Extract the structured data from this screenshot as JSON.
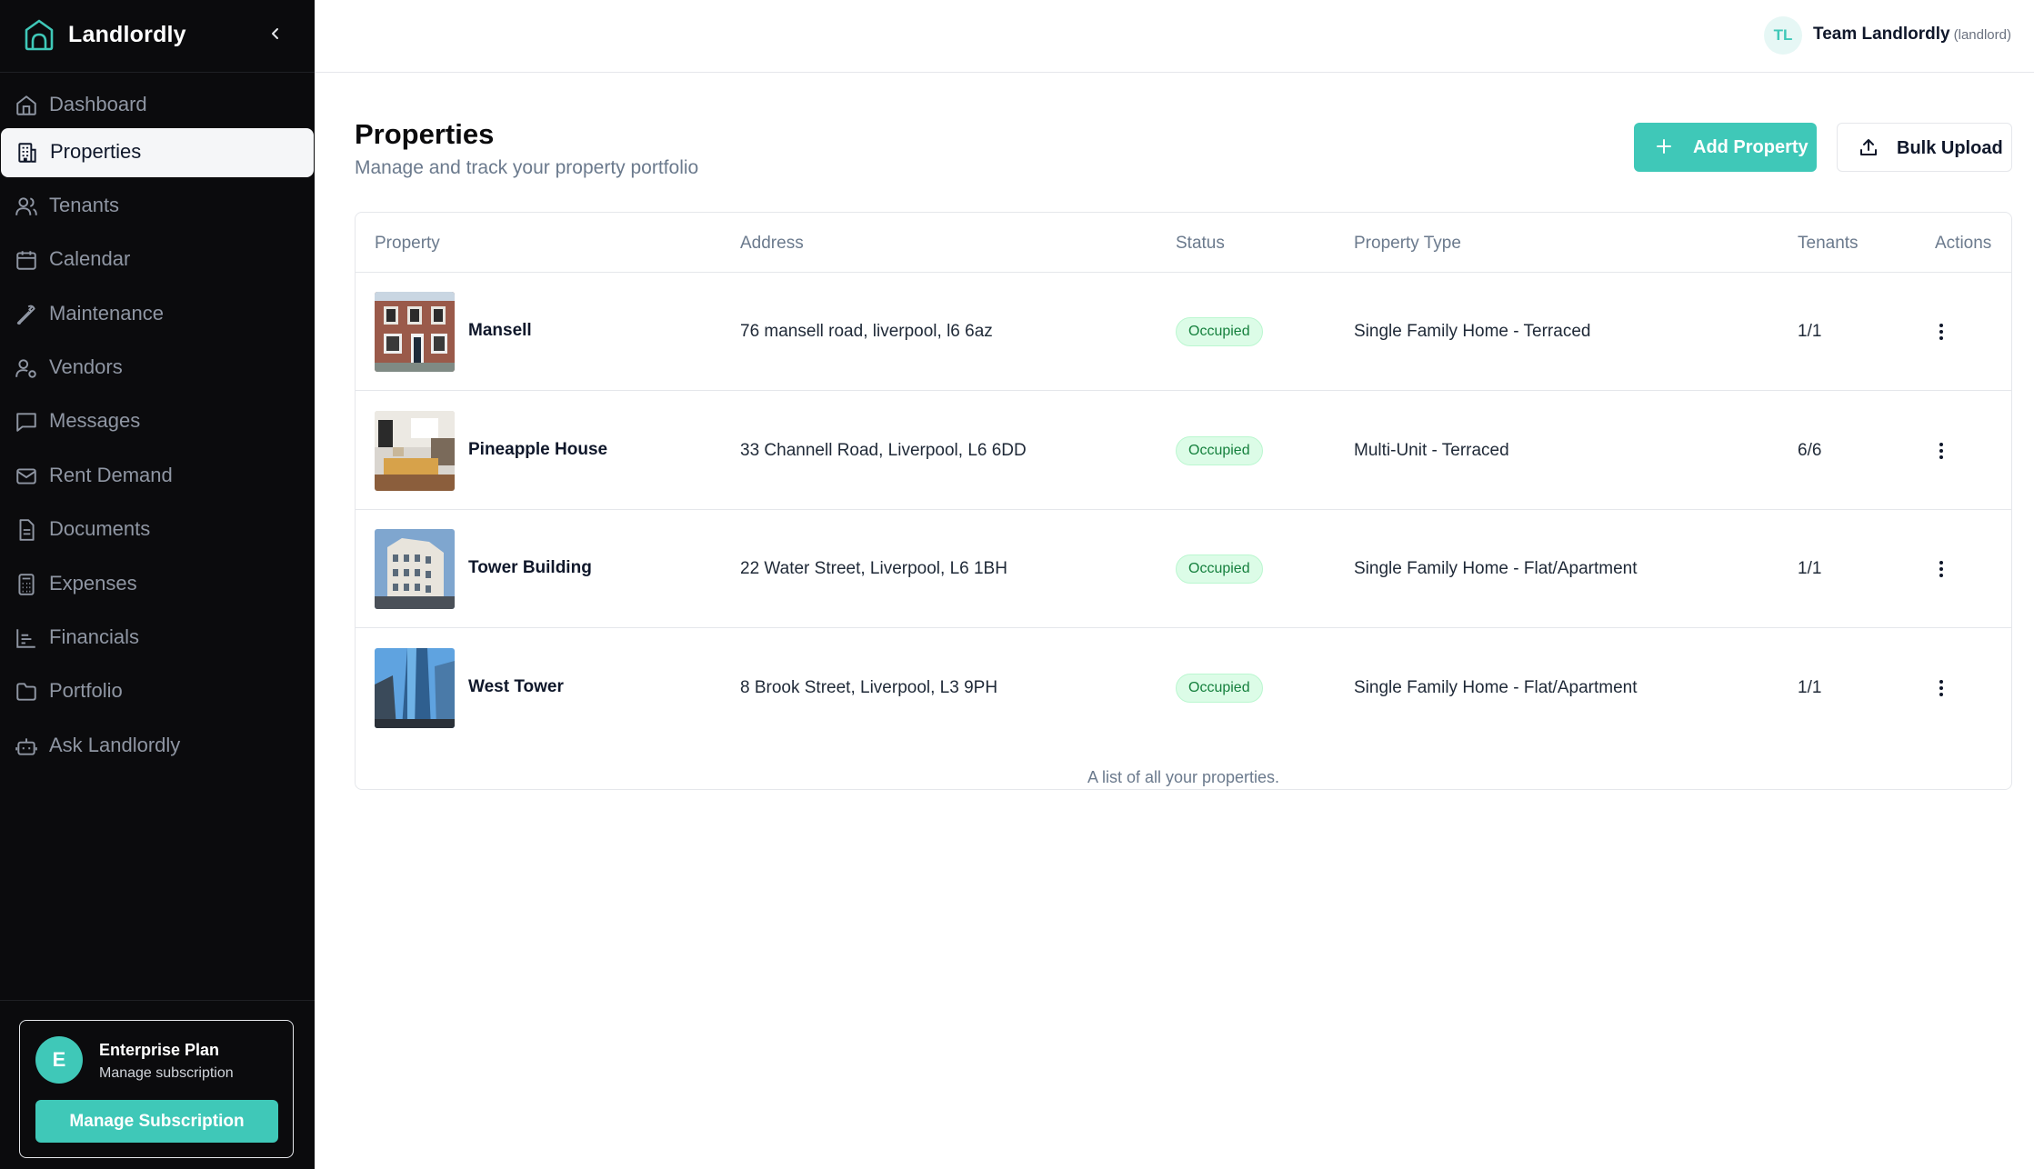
{
  "app": {
    "name": "Landlordly"
  },
  "sidebar": {
    "items": [
      {
        "label": "Dashboard",
        "icon": "home-icon"
      },
      {
        "label": "Properties",
        "icon": "building-icon",
        "active": true
      },
      {
        "label": "Tenants",
        "icon": "users-icon"
      },
      {
        "label": "Calendar",
        "icon": "calendar-icon"
      },
      {
        "label": "Maintenance",
        "icon": "wrench-icon"
      },
      {
        "label": "Vendors",
        "icon": "user-cog-icon"
      },
      {
        "label": "Messages",
        "icon": "message-icon"
      },
      {
        "label": "Rent Demand",
        "icon": "mail-icon"
      },
      {
        "label": "Documents",
        "icon": "file-icon"
      },
      {
        "label": "Expenses",
        "icon": "calculator-icon"
      },
      {
        "label": "Financials",
        "icon": "chart-icon"
      },
      {
        "label": "Portfolio",
        "icon": "folder-icon"
      },
      {
        "label": "Ask Landlordly",
        "icon": "bot-icon"
      }
    ],
    "plan": {
      "avatar": "E",
      "title": "Enterprise Plan",
      "subtitle": "Manage subscription",
      "button": "Manage Subscription"
    }
  },
  "topbar": {
    "user_initials": "TL",
    "user_name": "Team Landlordly",
    "user_role": "(landlord)"
  },
  "page": {
    "title": "Properties",
    "subtitle": "Manage and track your property portfolio",
    "add_button": "Add Property",
    "bulk_button": "Bulk Upload"
  },
  "table": {
    "headers": {
      "property": "Property",
      "address": "Address",
      "status": "Status",
      "type": "Property Type",
      "tenants": "Tenants",
      "actions": "Actions"
    },
    "rows": [
      {
        "name": "Mansell",
        "address": "76 mansell road, liverpool, l6 6az",
        "status": "Occupied",
        "type": "Single Family Home - Terraced",
        "tenants": "1/1"
      },
      {
        "name": "Pineapple House",
        "address": "33 Channell Road, Liverpool, L6 6DD",
        "status": "Occupied",
        "type": "Multi-Unit - Terraced",
        "tenants": "6/6"
      },
      {
        "name": "Tower Building",
        "address": "22 Water Street, Liverpool, L6 1BH",
        "status": "Occupied",
        "type": "Single Family Home - Flat/Apartment",
        "tenants": "1/1"
      },
      {
        "name": "West Tower",
        "address": "8 Brook Street, Liverpool, L3 9PH",
        "status": "Occupied",
        "type": "Single Family Home - Flat/Apartment",
        "tenants": "1/1"
      }
    ],
    "caption": "A list of all your properties."
  },
  "colors": {
    "accent": "#3fc8b8",
    "sidebar_bg": "#0b0b0d",
    "badge_bg": "#dcfce7",
    "badge_text": "#15803d"
  }
}
